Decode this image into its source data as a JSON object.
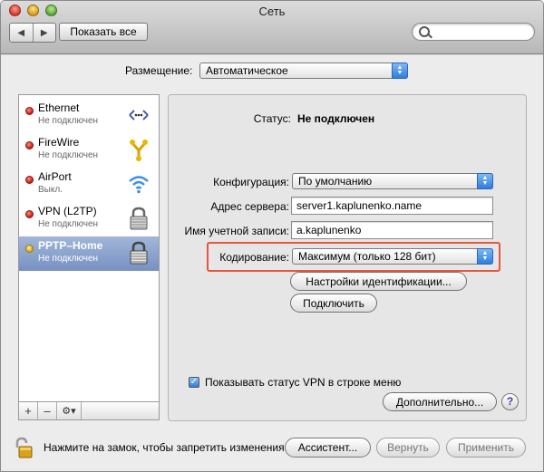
{
  "window": {
    "title": "Сеть"
  },
  "toolbar": {
    "back_label": "◀",
    "forward_label": "▶",
    "show_all_label": "Показать все",
    "search_placeholder": ""
  },
  "location": {
    "label": "Размещение:",
    "value": "Автоматическое"
  },
  "services": [
    {
      "name": "Ethernet",
      "status": "Не подключен",
      "dot": "red",
      "icon": "ethernet-icon"
    },
    {
      "name": "FireWire",
      "status": "Не подключен",
      "dot": "red",
      "icon": "firewire-icon"
    },
    {
      "name": "AirPort",
      "status": "Выкл.",
      "dot": "red",
      "icon": "airport-icon"
    },
    {
      "name": "VPN (L2TP)",
      "status": "Не подключен",
      "dot": "red",
      "icon": "lock-icon"
    },
    {
      "name": "PPTP–Home",
      "status": "Не подключен",
      "dot": "yellow",
      "icon": "lock-icon",
      "selected": true
    }
  ],
  "sidebar_controls": {
    "add": "+",
    "remove": "–",
    "gear": "⚙▾"
  },
  "detail": {
    "status_label": "Статус:",
    "status_value": "Не подключен",
    "config_label": "Конфигурация:",
    "config_value": "По умолчанию",
    "server_label": "Адрес сервера:",
    "server_value": "server1.kaplunenko.name",
    "account_label": "Имя учетной записи:",
    "account_value": "a.kaplunenko",
    "encryption_label": "Кодирование:",
    "encryption_value": "Максимум (только 128 бит)",
    "auth_settings_button": "Настройки идентификации...",
    "connect_button": "Подключить",
    "show_vpn_status_label": "Показывать статус VPN в строке меню",
    "show_vpn_status_checked": true,
    "advanced_button": "Дополнительно...",
    "help_label": "?"
  },
  "footer": {
    "lock_text": "Нажмите на замок, чтобы запретить изменения.",
    "assistant_button": "Ассистент...",
    "revert_button": "Вернуть",
    "apply_button": "Применить"
  },
  "colors": {
    "highlight": "#e8543d",
    "selection": "#7791c3",
    "accent": "#2f7de0"
  }
}
